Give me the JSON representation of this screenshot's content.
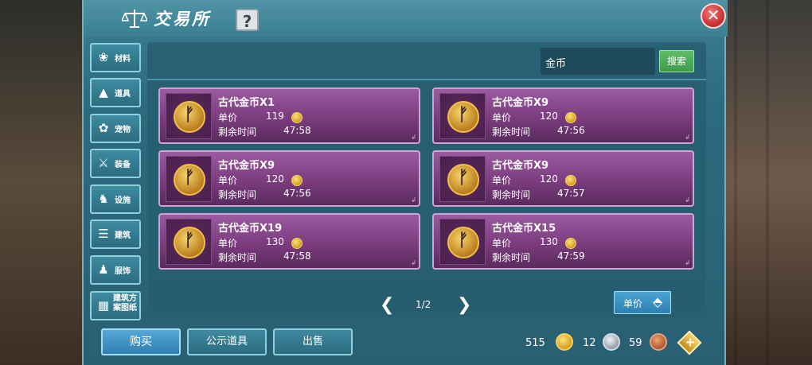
{
  "title": "交易所",
  "help_label": "?",
  "close_label": "✕",
  "sidebar": {
    "items": [
      {
        "label": "材料",
        "icon": "materials-icon",
        "glyph": "❀"
      },
      {
        "label": "道具",
        "icon": "potion-icon",
        "glyph": "▲"
      },
      {
        "label": "宠物",
        "icon": "paw-icon",
        "glyph": "✿"
      },
      {
        "label": "装备",
        "icon": "sword-icon",
        "glyph": "⚔"
      },
      {
        "label": "设施",
        "icon": "facility-icon",
        "glyph": "♞"
      },
      {
        "label": "建筑",
        "icon": "building-icon",
        "glyph": "☰"
      },
      {
        "label": "服饰",
        "icon": "clothes-icon",
        "glyph": "♟"
      },
      {
        "label": "建筑方案图纸",
        "icon": "blueprint-icon",
        "glyph": "▦"
      }
    ]
  },
  "search": {
    "value": "金币",
    "button_label": "搜索"
  },
  "listings": [
    {
      "name": "古代金币X1",
      "price_label": "单价",
      "price": "119",
      "time_label": "剩余时间",
      "time": "47:58"
    },
    {
      "name": "古代金币X9",
      "price_label": "单价",
      "price": "120",
      "time_label": "剩余时间",
      "time": "47:56"
    },
    {
      "name": "古代金币X9",
      "price_label": "单价",
      "price": "120",
      "time_label": "剩余时间",
      "time": "47:56"
    },
    {
      "name": "古代金币X9",
      "price_label": "单价",
      "price": "120",
      "time_label": "剩余时间",
      "time": "47:57"
    },
    {
      "name": "古代金币X19",
      "price_label": "单价",
      "price": "130",
      "time_label": "剩余时间",
      "time": "47:58"
    },
    {
      "name": "古代金币X15",
      "price_label": "单价",
      "price": "130",
      "time_label": "剩余时间",
      "time": "47:59"
    }
  ],
  "pager": {
    "prev": "❮",
    "next": "❯",
    "label": "1/2"
  },
  "sort": {
    "label": "单价",
    "arrow": "⬘"
  },
  "bottom": {
    "buy_label": "购买",
    "public_label": "公示道具",
    "sell_label": "出售",
    "gold": "515",
    "silver": "12",
    "bronze": "59",
    "plus_label": "+"
  },
  "colors": {
    "card": "#7b3c7e",
    "panel": "#2c6a7f",
    "search_button": "#3c9c48",
    "primary_button": "#2f7fb2",
    "close": "#c62a2a"
  }
}
